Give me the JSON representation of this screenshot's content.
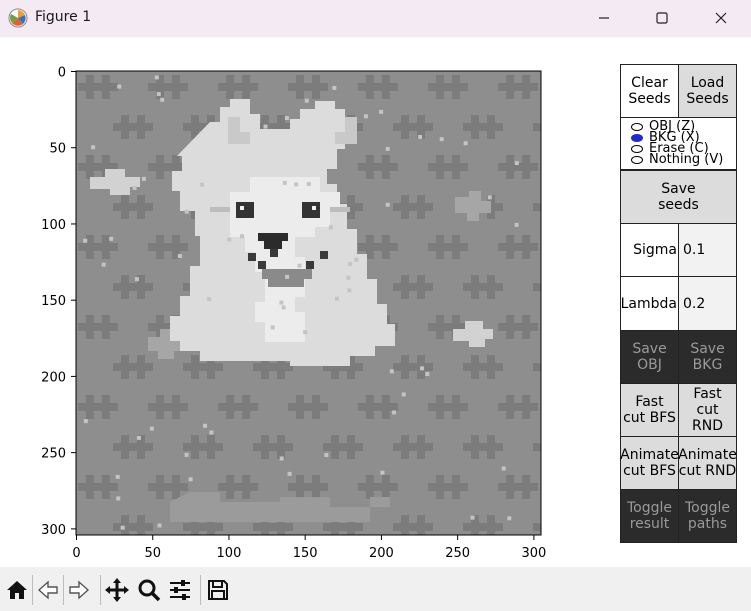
{
  "window": {
    "title": "Figure 1",
    "icon": "matplotlib-icon"
  },
  "axes": {
    "x_ticks": [
      "0",
      "50",
      "100",
      "150",
      "200",
      "250",
      "300"
    ],
    "y_ticks": [
      "0",
      "50",
      "100",
      "150",
      "200",
      "250",
      "300"
    ],
    "image_description": "pixel-art grayscale husky dog"
  },
  "panel": {
    "clear_seeds": "Clear\nSeeds",
    "load_seeds": "Load\nSeeds",
    "radio": [
      {
        "label": "OBJ (Z)",
        "selected": false
      },
      {
        "label": "BKG (X)",
        "selected": true
      },
      {
        "label": "Erase (C)",
        "selected": false
      },
      {
        "label": "Nothing (V)",
        "selected": false
      }
    ],
    "save_seeds": "Save\nseeds",
    "sigma_label": "Sigma",
    "sigma_value": "0.1",
    "lambda_label": "Lambda",
    "lambda_value": "0.2",
    "save_obj": "Save\nOBJ",
    "save_bkg": "Save\nBKG",
    "fast_cut_bfs": "Fast\ncut BFS",
    "fast_cut_rnd": "Fast\ncut RND",
    "animate_cut_bfs": "Animate\ncut BFS",
    "animate_cut_rnd": "Animate\ncut RND",
    "toggle_result": "Toggle\nresult",
    "toggle_paths": "Toggle\npaths"
  },
  "toolbar": {
    "icons": [
      "home-icon",
      "back-icon",
      "forward-icon",
      "pan-icon",
      "zoom-icon",
      "configure-subplots-icon",
      "save-figure-icon"
    ]
  }
}
